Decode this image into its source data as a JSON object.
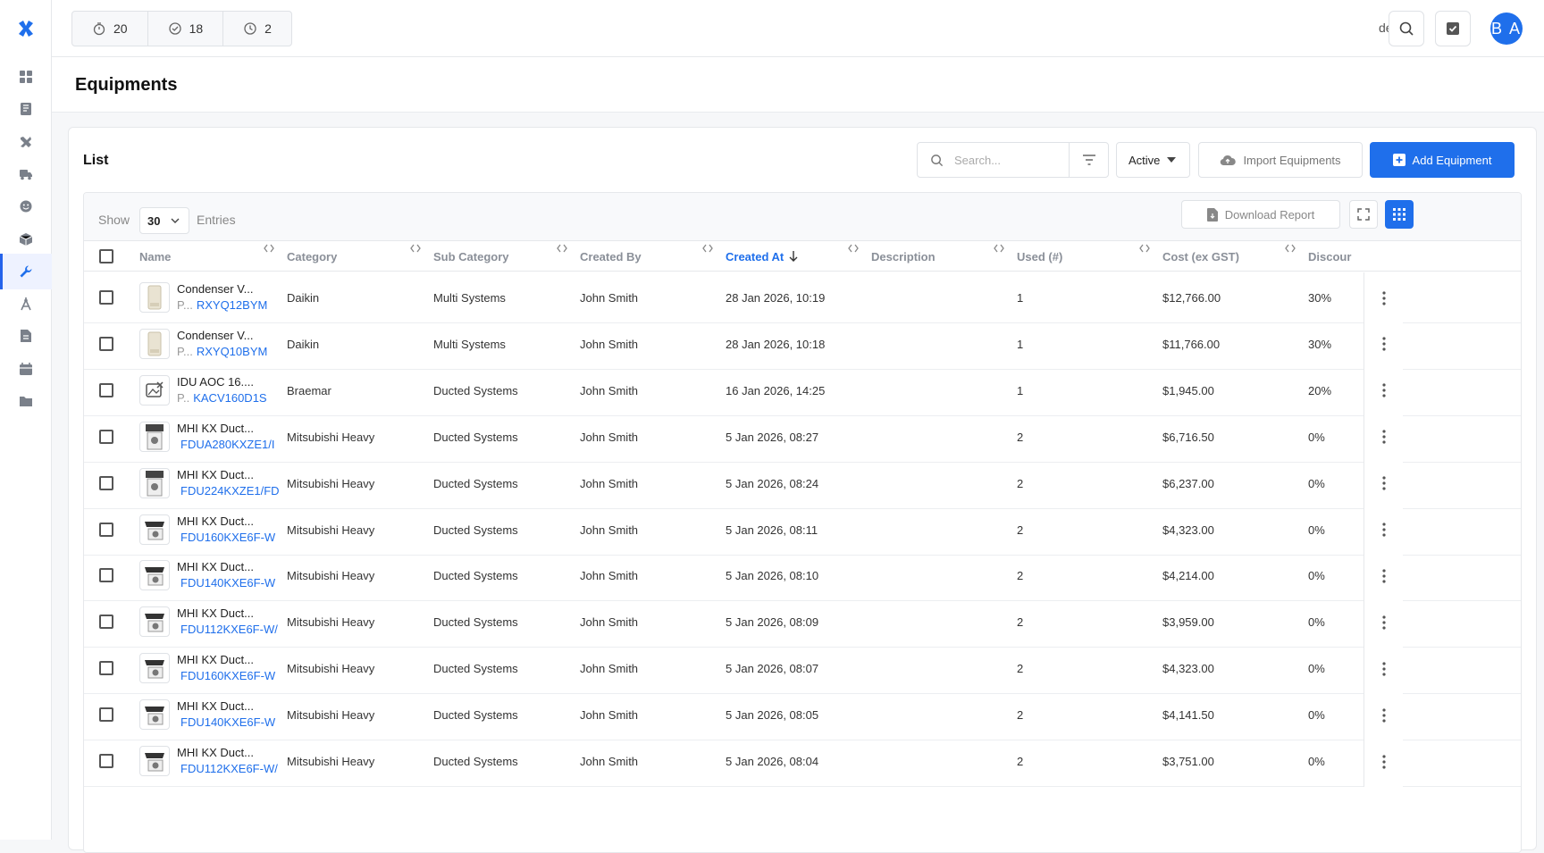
{
  "topbar": {
    "counters": [
      {
        "icon": "timer-icon",
        "value": "20"
      },
      {
        "icon": "check-circle-icon",
        "value": "18"
      },
      {
        "icon": "clock-icon",
        "value": "2"
      }
    ],
    "user_label": "demo",
    "avatar_initials": "B A"
  },
  "sidebar": {
    "items": [
      {
        "icon": "dashboard-icon"
      },
      {
        "icon": "book-icon"
      },
      {
        "icon": "tools-icon"
      },
      {
        "icon": "truck-icon"
      },
      {
        "icon": "smiley-icon"
      },
      {
        "icon": "box-icon"
      },
      {
        "icon": "wrench-icon",
        "active": true
      },
      {
        "icon": "compass-icon"
      },
      {
        "icon": "document-icon"
      },
      {
        "icon": "calendar-icon"
      },
      {
        "icon": "folder-icon"
      }
    ]
  },
  "page": {
    "title": "Equipments"
  },
  "card": {
    "title": "List",
    "search_placeholder": "Search...",
    "status_label": "Active",
    "import_label": "Import Equipments",
    "add_label": "Add Equipment",
    "show_label": "Show",
    "page_size": "30",
    "entries_label": "Entries",
    "download_label": "Download Report"
  },
  "table": {
    "columns": [
      {
        "key": "name",
        "label": "Name"
      },
      {
        "key": "category",
        "label": "Category"
      },
      {
        "key": "subcategory",
        "label": "Sub Category"
      },
      {
        "key": "created_by",
        "label": "Created By"
      },
      {
        "key": "created_at",
        "label": "Created At",
        "sorted": "desc"
      },
      {
        "key": "description",
        "label": "Description"
      },
      {
        "key": "used",
        "label": "Used (#)"
      },
      {
        "key": "cost",
        "label": "Cost (ex GST)"
      },
      {
        "key": "discount",
        "label": "Discour"
      }
    ],
    "rows": [
      {
        "name": "Condenser V...",
        "prefix": "P...",
        "code": "RXYQ12BYM",
        "thumb": "condenser",
        "category": "Daikin",
        "subcategory": "Multi Systems",
        "created_by": "John Smith",
        "created_at": "28 Jan 2026, 10:19",
        "description": "",
        "used": "1",
        "cost": "$12,766.00",
        "discount": "30%"
      },
      {
        "name": "Condenser V...",
        "prefix": "P...",
        "code": "RXYQ10BYM",
        "thumb": "condenser",
        "category": "Daikin",
        "subcategory": "Multi Systems",
        "created_by": "John Smith",
        "created_at": "28 Jan 2026, 10:18",
        "description": "",
        "used": "1",
        "cost": "$11,766.00",
        "discount": "30%"
      },
      {
        "name": "IDU AOC 16....",
        "prefix": "P..",
        "code": "KACV160D1S",
        "thumb": "none",
        "category": "Braemar",
        "subcategory": "Ducted Systems",
        "created_by": "John Smith",
        "created_at": "16 Jan 2026, 14:25",
        "description": "",
        "used": "1",
        "cost": "$1,945.00",
        "discount": "20%"
      },
      {
        "name": "MHI KX Duct...",
        "prefix": "",
        "code": "FDUA280KXZE1/I",
        "thumb": "unit-tall",
        "category": "Mitsubishi Heavy",
        "subcategory": "Ducted Systems",
        "created_by": "John Smith",
        "created_at": "5 Jan 2026, 08:27",
        "description": "",
        "used": "2",
        "cost": "$6,716.50",
        "discount": "0%"
      },
      {
        "name": "MHI KX Duct...",
        "prefix": "",
        "code": "FDU224KXZE1/FD",
        "thumb": "unit-tall",
        "category": "Mitsubishi Heavy",
        "subcategory": "Ducted Systems",
        "created_by": "John Smith",
        "created_at": "5 Jan 2026, 08:24",
        "description": "",
        "used": "2",
        "cost": "$6,237.00",
        "discount": "0%"
      },
      {
        "name": "MHI KX Duct...",
        "prefix": "",
        "code": "FDU160KXE6F-W",
        "thumb": "unit",
        "category": "Mitsubishi Heavy",
        "subcategory": "Ducted Systems",
        "created_by": "John Smith",
        "created_at": "5 Jan 2026, 08:11",
        "description": "",
        "used": "2",
        "cost": "$4,323.00",
        "discount": "0%"
      },
      {
        "name": "MHI KX Duct...",
        "prefix": "",
        "code": "FDU140KXE6F-W",
        "thumb": "unit",
        "category": "Mitsubishi Heavy",
        "subcategory": "Ducted Systems",
        "created_by": "John Smith",
        "created_at": "5 Jan 2026, 08:10",
        "description": "",
        "used": "2",
        "cost": "$4,214.00",
        "discount": "0%"
      },
      {
        "name": "MHI KX Duct...",
        "prefix": "",
        "code": "FDU112KXE6F-W/",
        "thumb": "unit",
        "category": "Mitsubishi Heavy",
        "subcategory": "Ducted Systems",
        "created_by": "John Smith",
        "created_at": "5 Jan 2026, 08:09",
        "description": "",
        "used": "2",
        "cost": "$3,959.00",
        "discount": "0%"
      },
      {
        "name": "MHI KX Duct...",
        "prefix": "",
        "code": "FDU160KXE6F-W",
        "thumb": "unit",
        "category": "Mitsubishi Heavy",
        "subcategory": "Ducted Systems",
        "created_by": "John Smith",
        "created_at": "5 Jan 2026, 08:07",
        "description": "",
        "used": "2",
        "cost": "$4,323.00",
        "discount": "0%"
      },
      {
        "name": "MHI KX Duct...",
        "prefix": "",
        "code": "FDU140KXE6F-W",
        "thumb": "unit",
        "category": "Mitsubishi Heavy",
        "subcategory": "Ducted Systems",
        "created_by": "John Smith",
        "created_at": "5 Jan 2026, 08:05",
        "description": "",
        "used": "2",
        "cost": "$4,141.50",
        "discount": "0%"
      },
      {
        "name": "MHI KX Duct...",
        "prefix": "",
        "code": "FDU112KXE6F-W/",
        "thumb": "unit",
        "category": "Mitsubishi Heavy",
        "subcategory": "Ducted Systems",
        "created_by": "John Smith",
        "created_at": "5 Jan 2026, 08:04",
        "description": "",
        "used": "2",
        "cost": "$3,751.00",
        "discount": "0%"
      }
    ]
  },
  "colors": {
    "accent": "#1f6feb",
    "muted": "#8a8f98"
  }
}
